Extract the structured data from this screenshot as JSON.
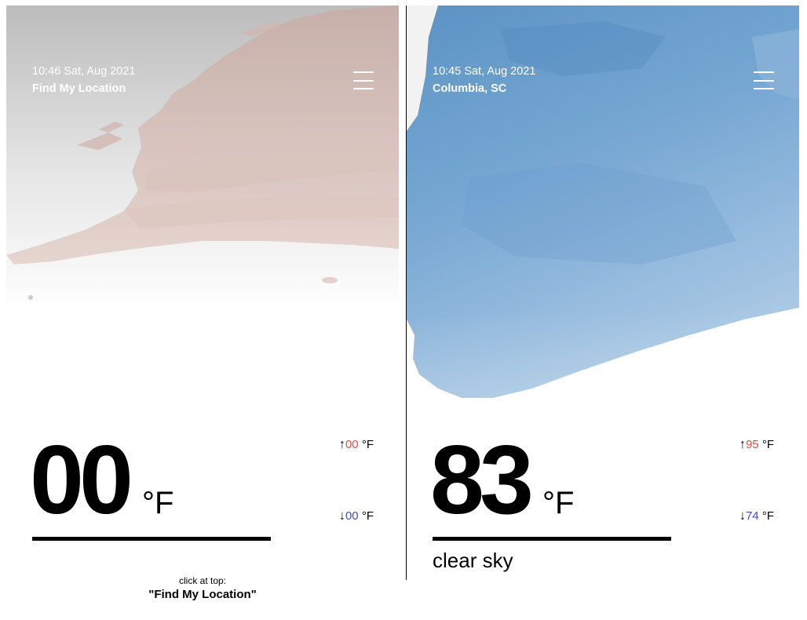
{
  "left": {
    "time": "10:46 Sat, Aug 2021",
    "location": "Find My Location",
    "temp": "00",
    "unit": "°F",
    "high": "00",
    "low": "00",
    "hint_line1": "click at top:",
    "hint_line2": "\"Find My Location\"",
    "sky_color": "#dcc5bf",
    "sky_top": "#bdbdbd"
  },
  "right": {
    "time": "10:45 Sat, Aug 2021",
    "location": "Columbia, SC",
    "temp": "83",
    "unit": "°F",
    "high": "95",
    "low": "74",
    "description": "clear sky",
    "sky_color": "#6e9fcb"
  },
  "symbols": {
    "up_arrow": "↑",
    "down_arrow": "↓",
    "hilo_unit": "°F"
  },
  "colors": {
    "high": "#e74c3c",
    "low": "#3f4ad1"
  }
}
